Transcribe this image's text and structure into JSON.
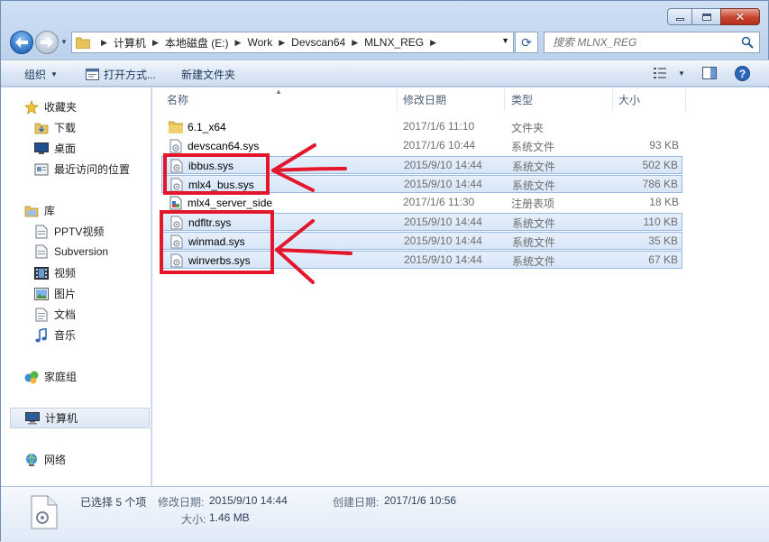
{
  "window": {
    "caption": {
      "minimize_icon": "minimize-icon",
      "maximize_icon": "maximize-icon",
      "close_glyph": "✕"
    }
  },
  "nav": {
    "breadcrumbs": [
      "计算机",
      "本地磁盘 (E:)",
      "Work",
      "Devscan64",
      "MLNX_REG"
    ],
    "search_placeholder": "搜索 MLNX_REG"
  },
  "toolbar": {
    "organize_label": "组织",
    "open_with_label": "打开方式...",
    "new_folder_label": "新建文件夹"
  },
  "sidebar": {
    "favorites": {
      "label": "收藏夹",
      "items": [
        "下载",
        "桌面",
        "最近访问的位置"
      ]
    },
    "libraries": {
      "label": "库",
      "items": [
        "PPTV视频",
        "Subversion",
        "视频",
        "图片",
        "文档",
        "音乐"
      ]
    },
    "homegroup": "家庭组",
    "computer": "计算机",
    "network": "网络"
  },
  "columns": {
    "name": "名称",
    "date": "修改日期",
    "type": "类型",
    "size": "大小"
  },
  "files": [
    {
      "name": "6.1_x64",
      "date": "2017/1/6 11:10",
      "type": "文件夹",
      "size": "",
      "icon": "folder-icon",
      "selected": false
    },
    {
      "name": "devscan64.sys",
      "date": "2017/1/6 10:44",
      "type": "系统文件",
      "size": "93 KB",
      "icon": "system-file-icon",
      "selected": false
    },
    {
      "name": "ibbus.sys",
      "date": "2015/9/10 14:44",
      "type": "系统文件",
      "size": "502 KB",
      "icon": "system-file-icon",
      "selected": true
    },
    {
      "name": "mlx4_bus.sys",
      "date": "2015/9/10 14:44",
      "type": "系统文件",
      "size": "786 KB",
      "icon": "system-file-icon",
      "selected": true
    },
    {
      "name": "mlx4_server_side",
      "date": "2017/1/6 11:30",
      "type": "注册表项",
      "size": "18 KB",
      "icon": "registry-file-icon",
      "selected": false
    },
    {
      "name": "ndfltr.sys",
      "date": "2015/9/10 14:44",
      "type": "系统文件",
      "size": "110 KB",
      "icon": "system-file-icon",
      "selected": true
    },
    {
      "name": "winmad.sys",
      "date": "2015/9/10 14:44",
      "type": "系统文件",
      "size": "35 KB",
      "icon": "system-file-icon",
      "selected": true
    },
    {
      "name": "winverbs.sys",
      "date": "2015/9/10 14:44",
      "type": "系统文件",
      "size": "67 KB",
      "icon": "system-file-icon",
      "selected": true
    }
  ],
  "details": {
    "selected_count": "已选择 5 个项",
    "modified_label": "修改日期:",
    "modified_value": "2015/9/10 14:44",
    "created_label": "创建日期:",
    "created_value": "2017/1/6 10:56",
    "size_label": "大小:",
    "size_value": "1.46 MB"
  },
  "colors": {
    "annotation_red": "#e3162c",
    "selection_blue": "#d7e6f8"
  }
}
